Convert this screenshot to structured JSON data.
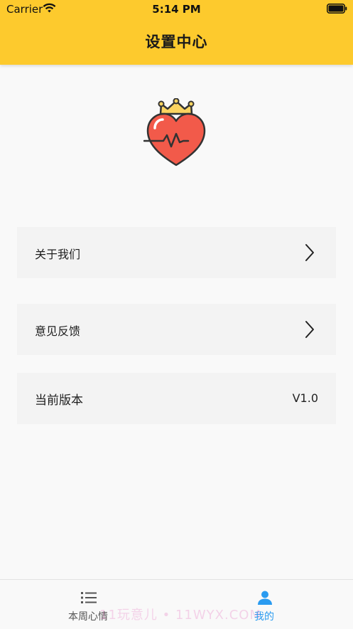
{
  "status_bar": {
    "carrier": "Carrier",
    "time": "5:14 PM",
    "wifi_icon": "wifi-icon",
    "battery_icon": "battery-full-icon"
  },
  "header": {
    "title": "设置中心",
    "background_color": "#fdca2d"
  },
  "logo": {
    "icon": "crowned-heart-heartbeat-icon",
    "heart_color": "#f25a4a",
    "crown_color": "#fbd460"
  },
  "settings_rows": [
    {
      "label": "关于我们",
      "icon": "chevron-right-icon"
    },
    {
      "label": "意见反馈",
      "icon": "chevron-right-icon"
    },
    {
      "label": "当前版本",
      "value": "V1.0"
    }
  ],
  "tabbar": {
    "tabs": [
      {
        "label": "本周心情",
        "icon": "list-icon",
        "active": false,
        "color": "#555555"
      },
      {
        "label": "我的",
        "icon": "person-icon",
        "active": true,
        "color": "#2a9bf0"
      }
    ]
  },
  "watermark": "11玩意儿 • 11WYX.COM"
}
